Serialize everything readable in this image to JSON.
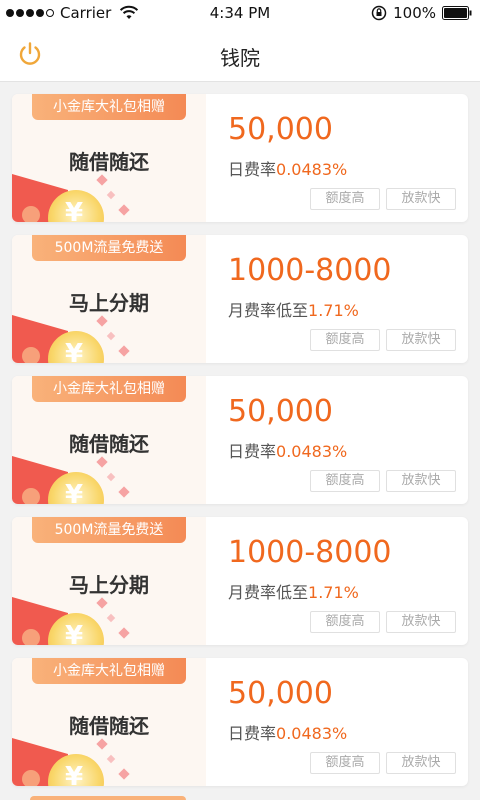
{
  "status_bar": {
    "carrier": "Carrier",
    "time": "4:34 PM",
    "battery": "100%"
  },
  "nav": {
    "title": "钱院"
  },
  "colors": {
    "accent": "#f0681e",
    "tag_gradient_start": "#f9b27a",
    "tag_gradient_end": "#f48a55",
    "power_icon": "#f0a73a"
  },
  "cards": [
    {
      "promo": "小金库大礼包相赠",
      "name": "随借随还",
      "amount": "50,000",
      "rate_label": "日费率",
      "rate_value": "0.0483%",
      "tag1": "额度高",
      "tag2": "放款快"
    },
    {
      "promo": "500M流量免费送",
      "name": "马上分期",
      "amount": "1000-8000",
      "rate_label": "月费率低至",
      "rate_value": "1.71%",
      "tag1": "额度高",
      "tag2": "放款快"
    },
    {
      "promo": "小金库大礼包相赠",
      "name": "随借随还",
      "amount": "50,000",
      "rate_label": "日费率",
      "rate_value": "0.0483%",
      "tag1": "额度高",
      "tag2": "放款快"
    },
    {
      "promo": "500M流量免费送",
      "name": "马上分期",
      "amount": "1000-8000",
      "rate_label": "月费率低至",
      "rate_value": "1.71%",
      "tag1": "额度高",
      "tag2": "放款快"
    },
    {
      "promo": "小金库大礼包相赠",
      "name": "随借随还",
      "amount": "50,000",
      "rate_label": "日费率",
      "rate_value": "0.0483%",
      "tag1": "额度高",
      "tag2": "放款快"
    }
  ]
}
